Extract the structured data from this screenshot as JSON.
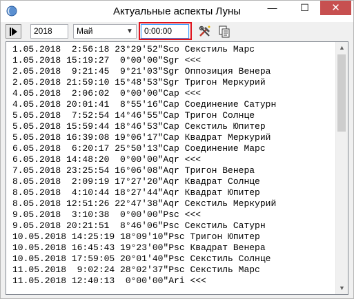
{
  "window": {
    "title": "Актуальные аспекты Луны",
    "minimize_glyph": "—",
    "maximize_glyph": "☐",
    "close_glyph": "✕"
  },
  "toolbar": {
    "year": "2018",
    "month": "Май",
    "time": "0:00:00",
    "highlight_color": "#e0141e"
  },
  "aspects": [
    "1.05.2018  2:56:18 23°29'52\"Sco Секстиль Марс",
    "1.05.2018 15:19:27  0°00'00\"Sgr <<<",
    "2.05.2018  9:21:45  9°21'03\"Sgr Оппозиция Венера",
    "2.05.2018 21:59:10 15°48'53\"Sgr Тригон Меркурий",
    "4.05.2018  2:06:02  0°00'00\"Cap <<<",
    "4.05.2018 20:01:41  8°55'16\"Cap Соединение Сатурн",
    "5.05.2018  7:52:54 14°46'55\"Cap Тригон Солнце",
    "5.05.2018 15:59:44 18°46'53\"Cap Секстиль Юпитер",
    "5.05.2018 16:39:08 19°06'17\"Cap Квадрат Меркурий",
    "6.05.2018  6:20:17 25°50'13\"Cap Соединение Марс",
    "6.05.2018 14:48:20  0°00'00\"Aqr <<<",
    "7.05.2018 23:25:54 16°06'08\"Aqr Тригон Венера",
    "8.05.2018  2:09:19 17°27'20\"Aqr Квадрат Солнце",
    "8.05.2018  4:10:44 18°27'44\"Aqr Квадрат Юпитер",
    "8.05.2018 12:51:26 22°47'38\"Aqr Секстиль Меркурий",
    "9.05.2018  3:10:38  0°00'00\"Psc <<<",
    "9.05.2018 20:21:51  8°46'06\"Psc Секстиль Сатурн",
    "10.05.2018 14:25:19 18°09'10\"Psc Тригон Юпитер",
    "10.05.2018 16:45:43 19°23'00\"Psc Квадрат Венера",
    "10.05.2018 17:59:05 20°01'40\"Psc Секстиль Солнце",
    "11.05.2018  9:02:24 28°02'37\"Psc Секстиль Марс",
    "11.05.2018 12:40:13  0°00'00\"Ari <<<"
  ]
}
